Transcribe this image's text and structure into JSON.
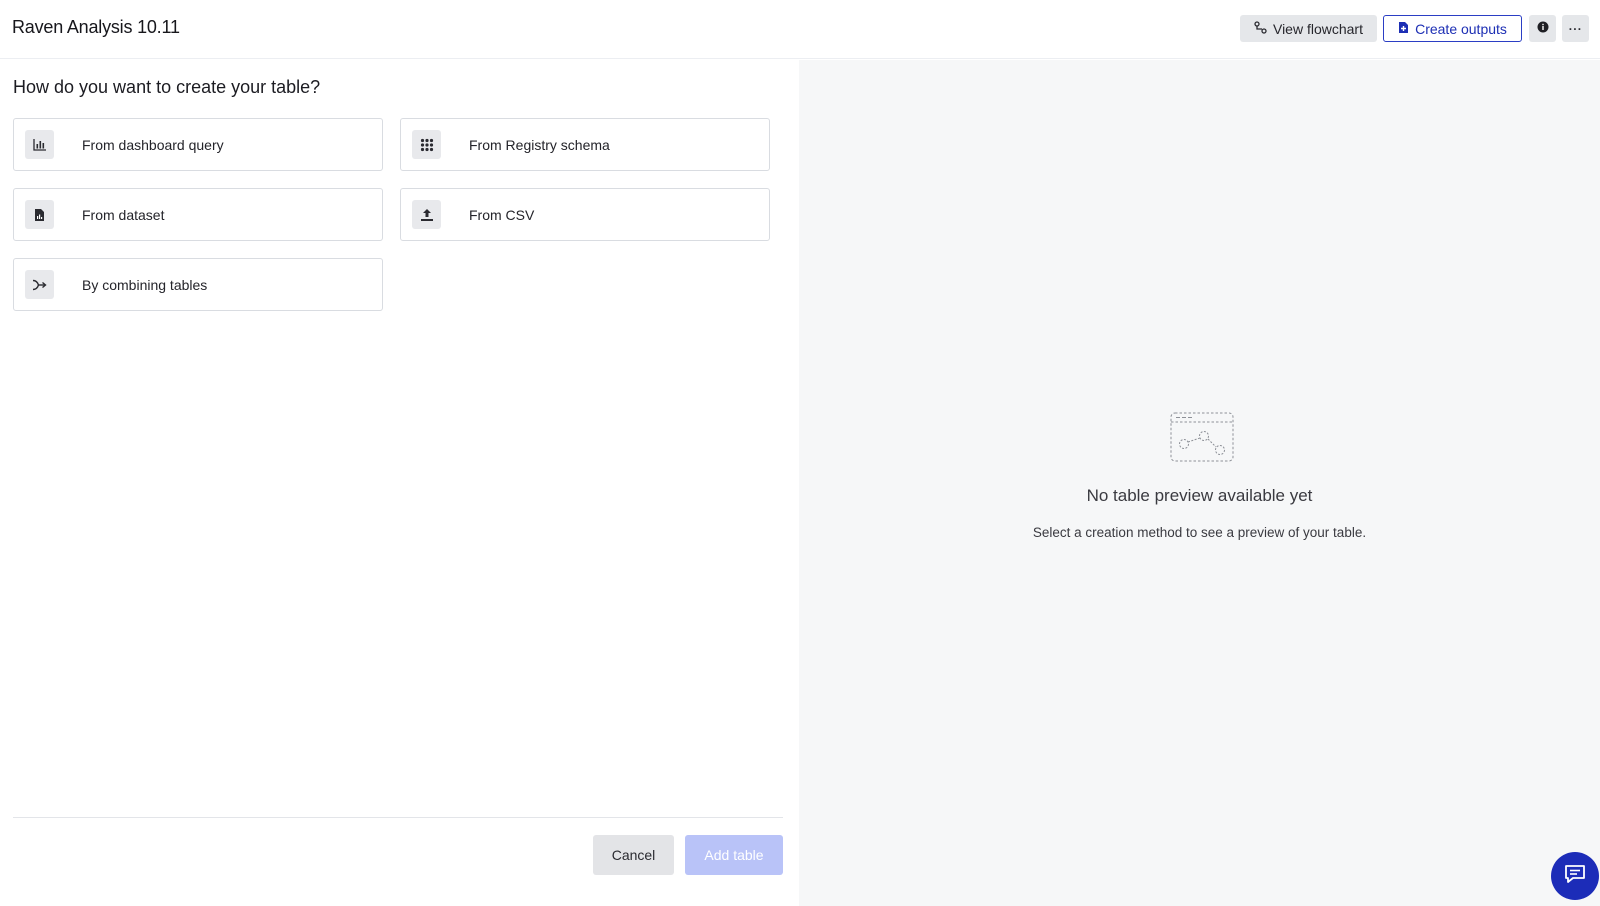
{
  "header": {
    "title": "Raven Analysis 10.11",
    "view_flowchart": "View flowchart",
    "create_outputs": "Create outputs",
    "more_label": "···"
  },
  "main": {
    "question": "How do you want to create your table?",
    "options": [
      {
        "label": "From dashboard query",
        "icon": "bar-chart-icon"
      },
      {
        "label": "From Registry schema",
        "icon": "grid-dots-icon"
      },
      {
        "label": "From dataset",
        "icon": "file-chart-icon"
      },
      {
        "label": "From CSV",
        "icon": "upload-icon"
      },
      {
        "label": "By combining tables",
        "icon": "merge-arrow-icon"
      }
    ],
    "cancel": "Cancel",
    "add_table": "Add table"
  },
  "preview": {
    "title": "No table preview available yet",
    "subtitle": "Select a creation method to see a preview of your table."
  },
  "colors": {
    "accent": "#1c2cb8",
    "disabled_primary": "#b9c3f8",
    "panel_bg": "#f6f7f8"
  }
}
